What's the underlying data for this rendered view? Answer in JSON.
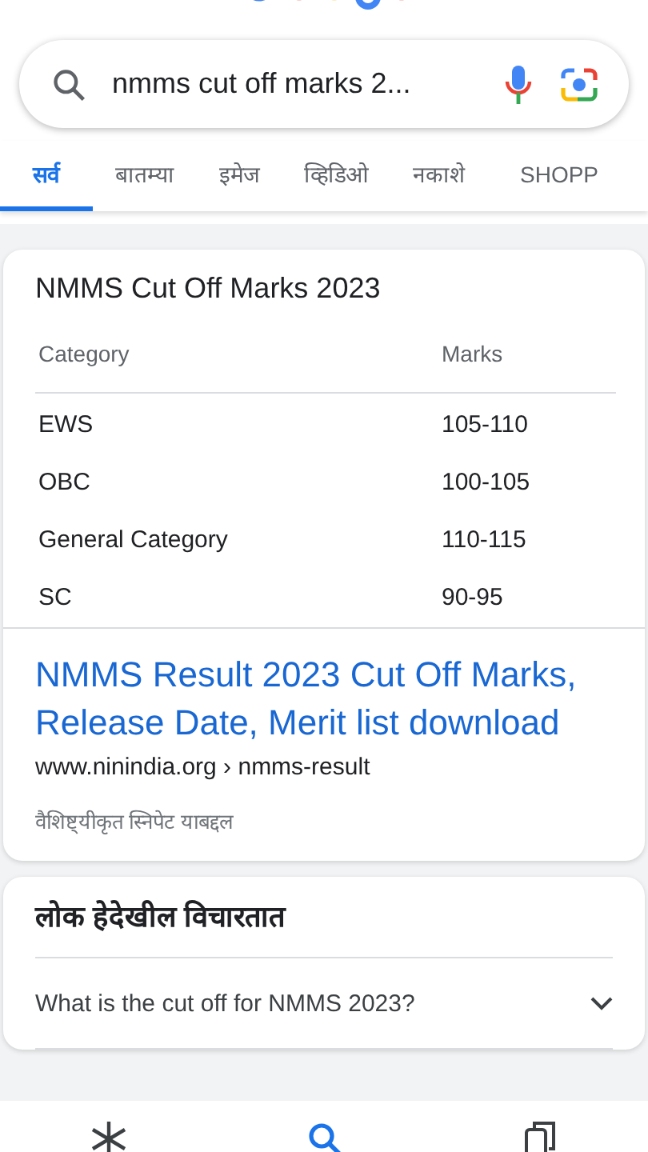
{
  "search": {
    "value": "nmms cut off marks 2..."
  },
  "tabs": [
    {
      "label": "सर्व",
      "selected": true
    },
    {
      "label": "बातम्या",
      "selected": false
    },
    {
      "label": "इमेज",
      "selected": false
    },
    {
      "label": "व्हिडिओ",
      "selected": false
    },
    {
      "label": "नकाशे",
      "selected": false
    },
    {
      "label": "SHOPP",
      "selected": false
    }
  ],
  "snippet": {
    "title": "NMMS Cut Off Marks 2023",
    "table": {
      "columns": [
        "Category",
        "Marks"
      ],
      "rows": [
        [
          "EWS",
          "105-110"
        ],
        [
          "OBC",
          "100-105"
        ],
        [
          "General Category",
          "110-115"
        ],
        [
          "SC",
          "90-95"
        ]
      ]
    },
    "link": "NMMS Result 2023 Cut Off Marks, Release Date, Merit list download",
    "url": "www.ninindia.org › nmms-result",
    "about": "वैशिष्ट्यीकृत स्निपेट याबद्दल"
  },
  "people_also_ask": {
    "title": "लोक हेदेखील विचारतात",
    "questions": [
      {
        "text": "What is the cut off for NMMS 2023?",
        "expanded": false
      }
    ]
  },
  "bottom_nav": [
    {
      "kind": "discover",
      "selected": false
    },
    {
      "kind": "search",
      "selected": true
    },
    {
      "kind": "tabs",
      "selected": false
    }
  ]
}
